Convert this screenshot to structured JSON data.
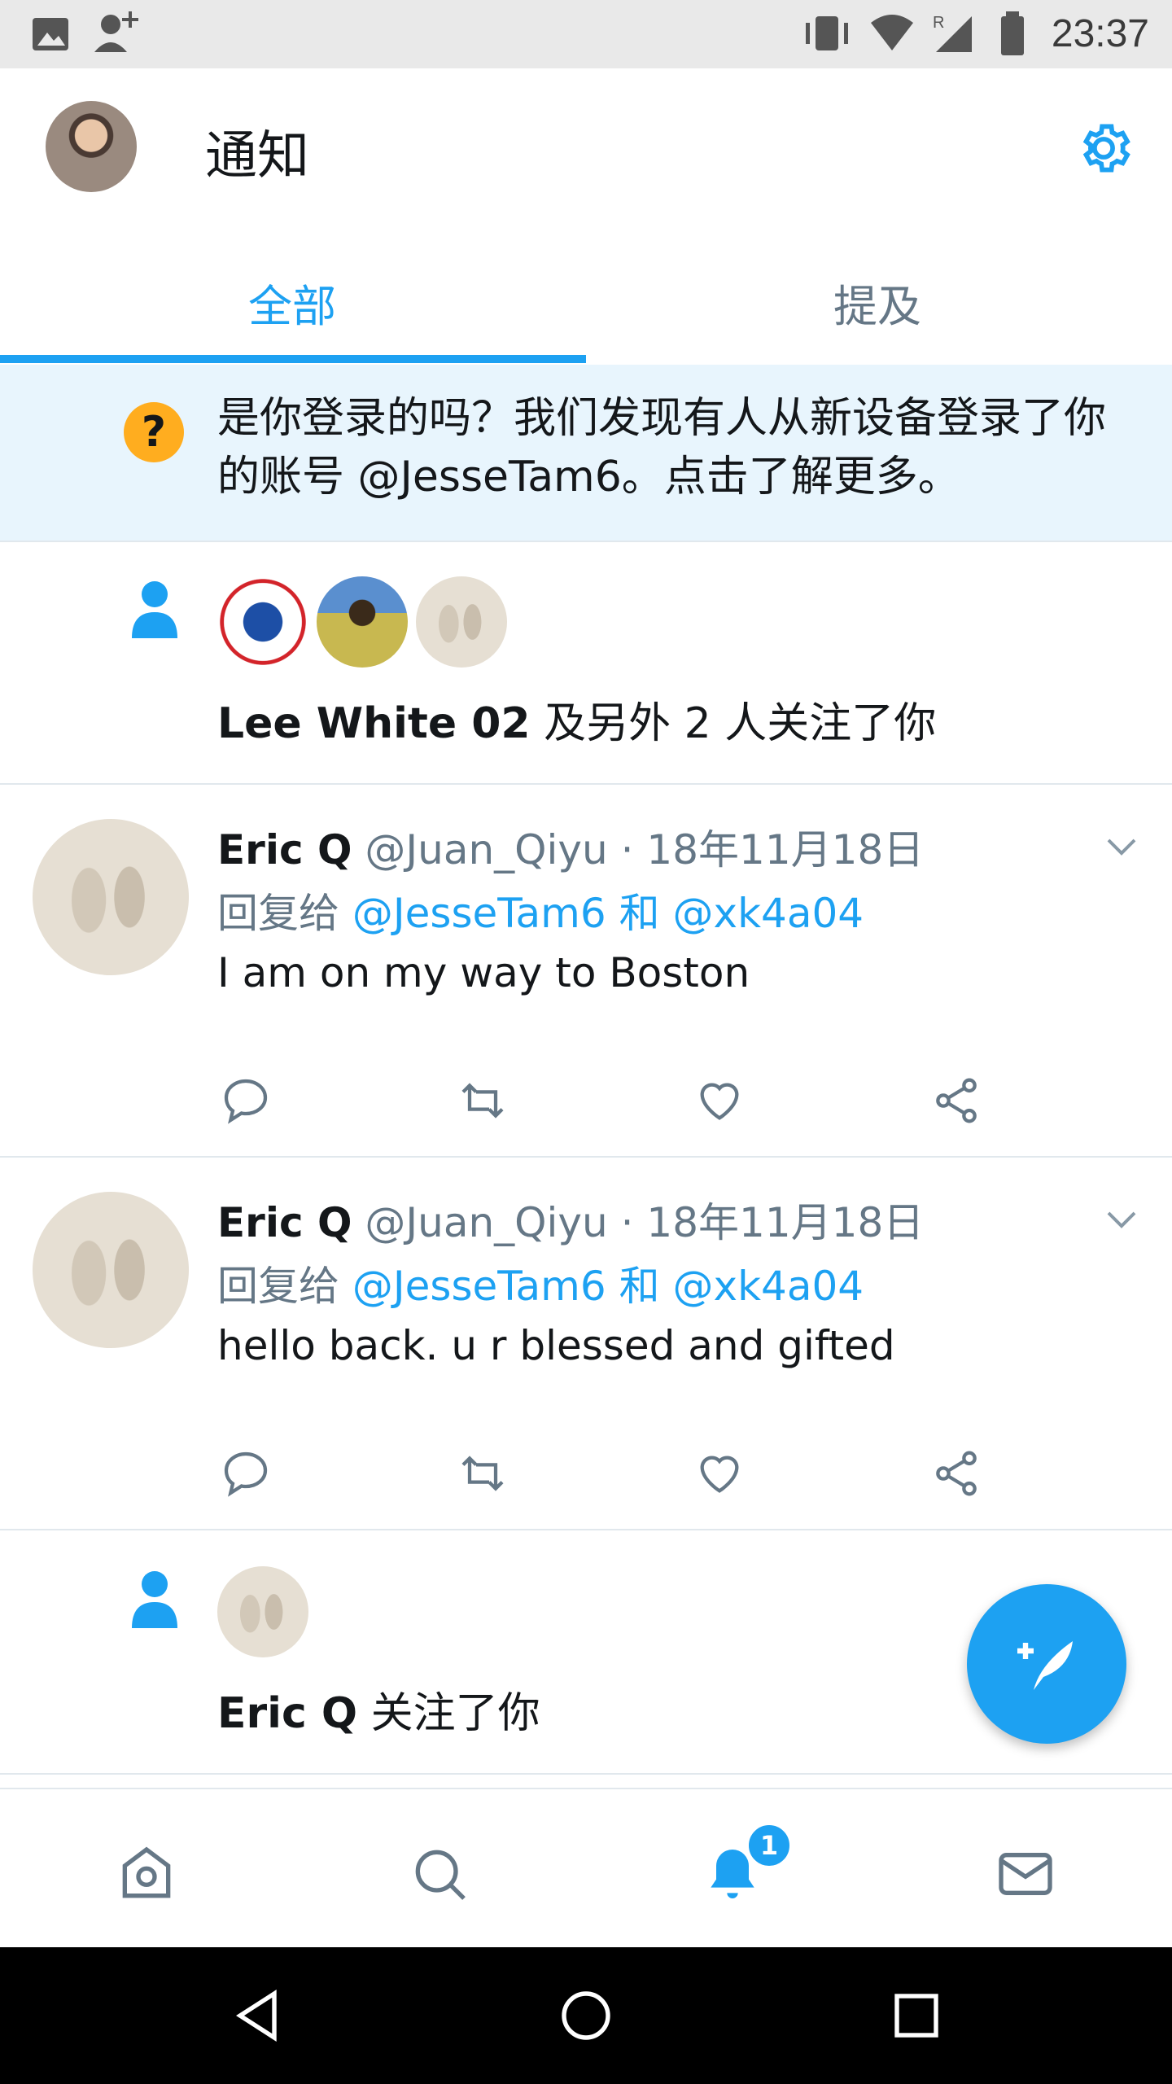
{
  "status_bar": {
    "time": "23:37"
  },
  "header": {
    "title": "通知"
  },
  "tabs": [
    {
      "label": "全部",
      "active": true
    },
    {
      "label": "提及",
      "active": false
    }
  ],
  "banner": {
    "text": "是你登录的吗？我们发现有人从新设备登录了你的账号 @JesseTam6。点击了解更多。",
    "icon": "question-icon"
  },
  "follow_group": {
    "name": "Lee White 02",
    "rest": " 及另外 2 人关注了你"
  },
  "tweets": [
    {
      "name": "Eric Q",
      "meta": " @Juan_Qiyu · 18年11月18日",
      "reply_prefix": "回复给 ",
      "reply_links": "@JesseTam6 和 @xk4a04",
      "body": "I am on my way to Boston"
    },
    {
      "name": "Eric Q",
      "meta": " @Juan_Qiyu · 18年11月18日",
      "reply_prefix": "回复给 ",
      "reply_links": "@JesseTam6 和 @xk4a04",
      "body": "hello back. u r blessed and gifted"
    }
  ],
  "follow_single": {
    "name": "Eric Q",
    "rest": " 关注了你"
  },
  "bottom_nav": {
    "items": [
      "home-icon",
      "search-icon",
      "notifications-icon",
      "messages-icon"
    ],
    "notification_badge": "1"
  },
  "colors": {
    "accent": "#1da1f2",
    "banner_bg": "#e8f5fd",
    "warning": "#ffad1f"
  }
}
